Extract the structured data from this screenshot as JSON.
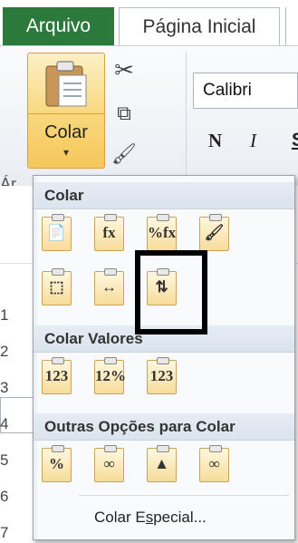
{
  "tabs": {
    "file": "Arquivo",
    "home": "Página Inicial"
  },
  "clipboard": {
    "paste_label": "Colar",
    "paste_arrow": "▾",
    "group_label": "Ár"
  },
  "font": {
    "name": "Calibri",
    "bold": "N",
    "italic": "I",
    "underline": "S"
  },
  "rows": [
    "1",
    "2",
    "3",
    "4",
    "5",
    "6",
    "7"
  ],
  "menu": {
    "section_paste": "Colar",
    "section_values": "Colar Valores",
    "section_other": "Outras Opções para Colar",
    "paste_special_pre": "Colar E",
    "paste_special_u": "s",
    "paste_special_post": "pecial...",
    "paste_icons": [
      {
        "name": "paste-icon",
        "glyph": "📄"
      },
      {
        "name": "paste-formulas-icon",
        "glyph": "fx"
      },
      {
        "name": "paste-formulas-number-format-icon",
        "glyph": "%fx"
      },
      {
        "name": "keep-source-formatting-icon",
        "glyph": "🖌"
      },
      {
        "name": "no-borders-icon",
        "glyph": "⬚"
      },
      {
        "name": "keep-column-widths-icon",
        "glyph": "↔"
      },
      {
        "name": "transpose-icon",
        "glyph": "⇅"
      }
    ],
    "value_icons": [
      {
        "name": "values-icon",
        "glyph": "123"
      },
      {
        "name": "values-number-format-icon",
        "glyph": "12%"
      },
      {
        "name": "values-source-format-icon",
        "glyph": "123"
      }
    ],
    "other_icons": [
      {
        "name": "formatting-icon",
        "glyph": "%"
      },
      {
        "name": "paste-link-icon",
        "glyph": "∞"
      },
      {
        "name": "picture-icon",
        "glyph": "▲"
      },
      {
        "name": "linked-picture-icon",
        "glyph": "∞"
      }
    ]
  }
}
